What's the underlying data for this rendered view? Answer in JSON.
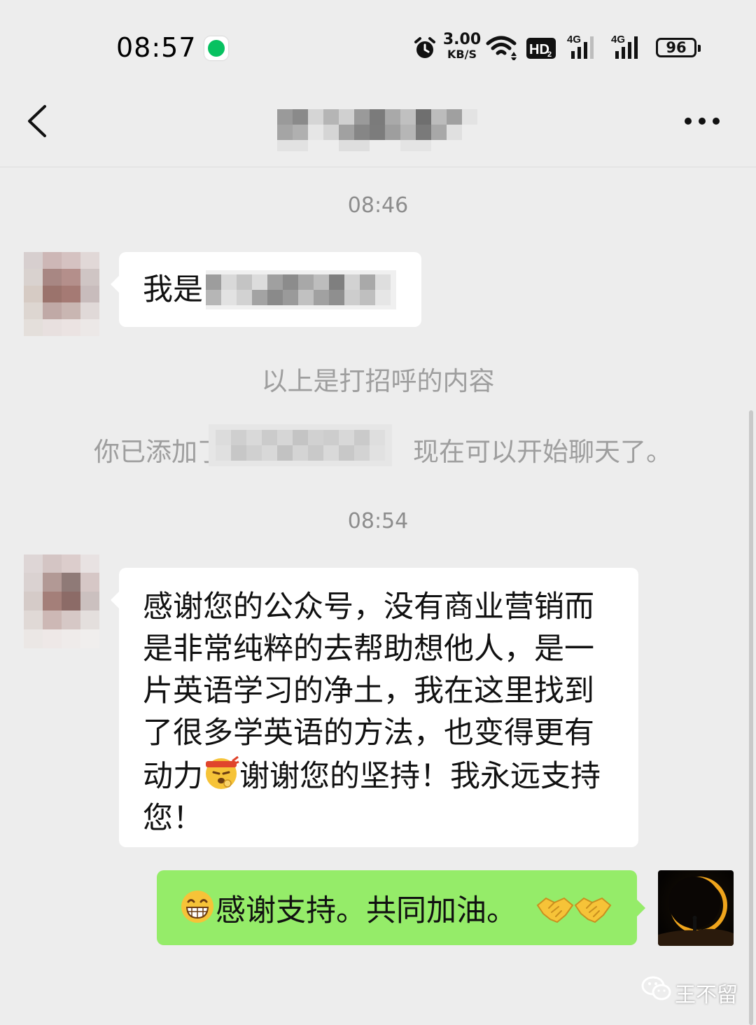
{
  "status_bar": {
    "time": "08:57",
    "network_speed_value": "3.00",
    "network_speed_unit": "KB/S",
    "signal_1_label": "4G",
    "signal_2_label": "4G",
    "hd_label": "HD",
    "battery_level": "96"
  },
  "header": {
    "contact_name_blurred": true
  },
  "chat": {
    "timestamp_1": "08:46",
    "greeting_message_visible_prefix": "我是",
    "system_note_1": "以上是打招呼的内容",
    "system_note_2_prefix": "你已添加了",
    "system_note_2_suffix": "现在可以开始聊天了。",
    "timestamp_2": "08:54",
    "incoming_message_part_1": "感谢您的公众号，没有商业营销而是非常纯粹的去帮助想他人，是一片英语学习的净土，我在这里找到了很多学英语的方法，也变得更有动力",
    "incoming_message_part_2": "谢谢您的坚持！我永远支持您！",
    "reply_message": "感谢支持。共同加油。",
    "reply_emojis": [
      "grinning-face-icon",
      "handshake-icon",
      "handshake-icon"
    ]
  },
  "watermark": {
    "text": "王不留"
  },
  "colors": {
    "background": "#ededed",
    "incoming_bubble": "#ffffff",
    "outgoing_bubble": "#95ec69",
    "system_text": "#9e9e9e",
    "wechat_green": "#07c160"
  }
}
